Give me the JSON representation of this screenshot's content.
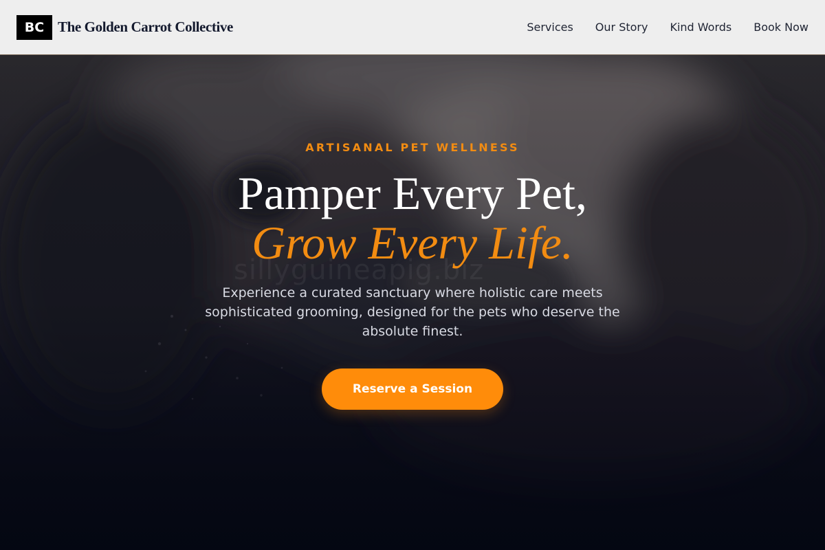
{
  "header": {
    "logo_text": "BC",
    "brand_name": "The Golden Carrot Collective",
    "nav": [
      "Services",
      "Our Story",
      "Kind Words",
      "Book Now"
    ]
  },
  "hero": {
    "eyebrow": "ARTISANAL PET WELLNESS",
    "headline_line1": "Pamper Every Pet,",
    "headline_line2": "Grow Every Life.",
    "subtext": "Experience a curated sanctuary where holistic care meets sophisticated grooming, designed for the pets who deserve the absolute finest.",
    "cta_label": "Reserve a Session",
    "watermark": "sillyguineapig.biz"
  },
  "colors": {
    "accent": "#f28c12",
    "button": "#ff8c0a",
    "header_bg": "#eeeeee",
    "hero_bottom": "#060914"
  }
}
